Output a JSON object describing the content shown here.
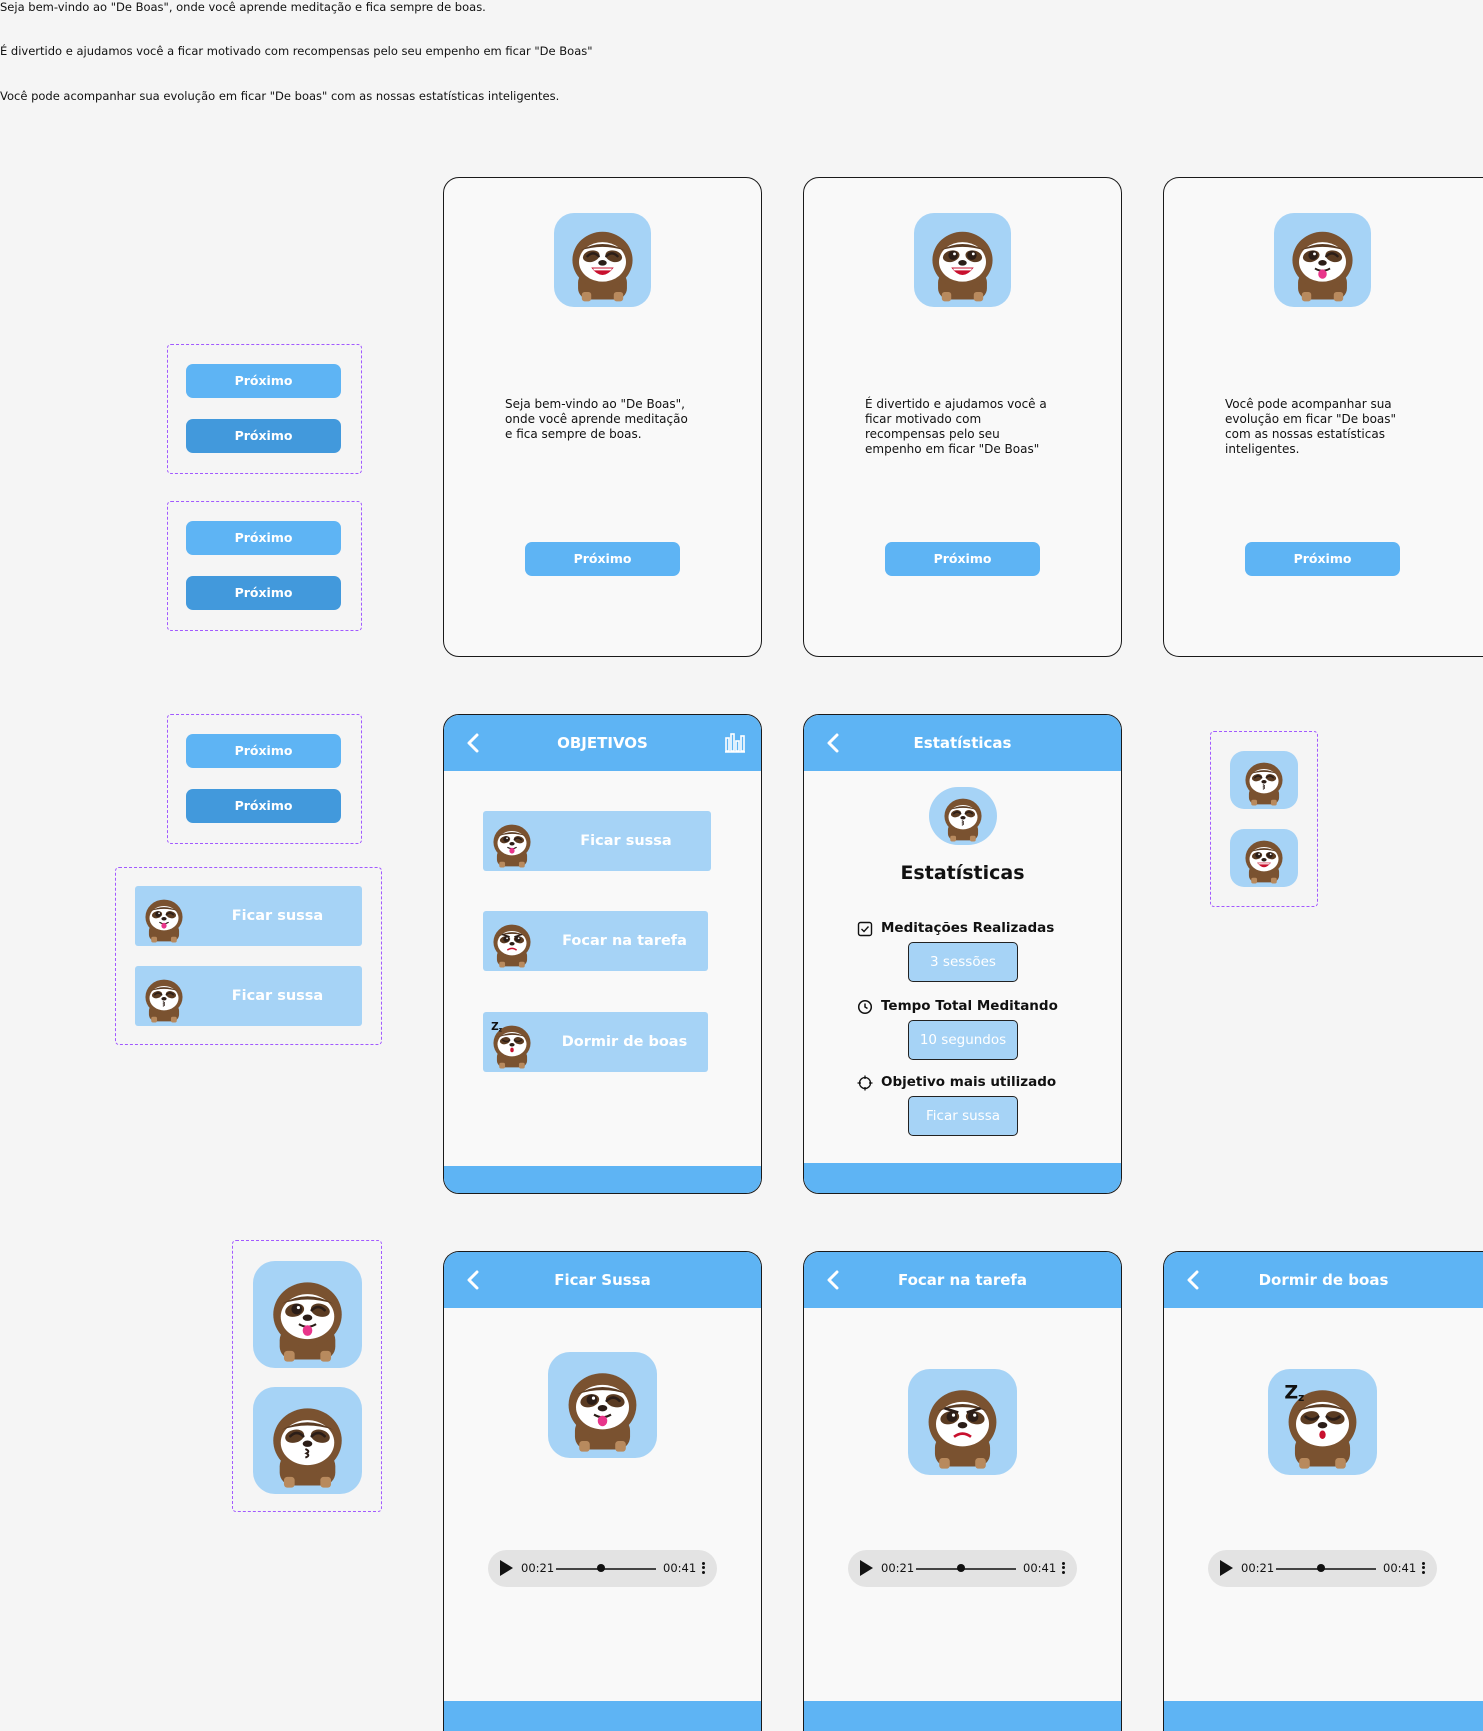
{
  "notes": {
    "line1": "Seja bem-vindo ao \"De Boas\", onde você aprende meditação e fica sempre de boas.",
    "line2": "É divertido e ajudamos você a ficar motivado com recompensas pelo seu empenho em ficar \"De Boas\"",
    "line3": "Você pode acompanhar sua evolução em ficar \"De boas\" com as nossas estatísticas inteligentes."
  },
  "components": {
    "next_label": "Próximo",
    "goal_label": "Ficar sussa"
  },
  "onboarding": [
    {
      "text": "Seja bem-vindo ao \"De Boas\", onde você aprende meditação e fica sempre de boas.",
      "button": "Próximo",
      "mood": "laughing"
    },
    {
      "text": "É divertido e ajudamos você a ficar motivado com recompensas pelo seu empenho em ficar \"De Boas\"",
      "button": "Próximo",
      "mood": "laughing-open"
    },
    {
      "text": "Você pode acompanhar sua evolução em ficar \"De boas\" com as nossas estatísticas inteligentes.",
      "button": "Próximo",
      "mood": "wink-tongue"
    }
  ],
  "objectives": {
    "title": "OBJETIVOS",
    "goals": [
      {
        "label": "Ficar sussa",
        "mood": "wink-tongue"
      },
      {
        "label": "Focar na tarefa",
        "mood": "focused"
      },
      {
        "label": "Dormir de boas",
        "mood": "sleeping"
      }
    ]
  },
  "statistics": {
    "header": "Estatísticas",
    "title": "Estatísticas",
    "items": [
      {
        "label": "Meditações Realizadas",
        "value": "3 sessões",
        "icon": "check-square-icon"
      },
      {
        "label": "Tempo Total Meditando",
        "value": "10 segundos",
        "icon": "clock-icon"
      },
      {
        "label": "Objetivo mais utilizado",
        "value": "Ficar sussa",
        "icon": "target-icon"
      }
    ]
  },
  "sessions": [
    {
      "title": "Ficar Sussa",
      "current": "00:21",
      "total": "00:41",
      "progress": 0.5,
      "mood": "wink-tongue"
    },
    {
      "title": "Focar na tarefa",
      "current": "00:21",
      "total": "00:41",
      "progress": 0.5,
      "mood": "focused"
    },
    {
      "title": "Dormir de boas",
      "current": "00:21",
      "total": "00:41",
      "progress": 0.5,
      "mood": "sleeping"
    }
  ],
  "colors": {
    "primary": "#5eb4f4",
    "primary_dark": "#4299dc",
    "light_blue": "#a6d3f6",
    "component_border": "#a259ff",
    "background": "#f5f5f5"
  }
}
